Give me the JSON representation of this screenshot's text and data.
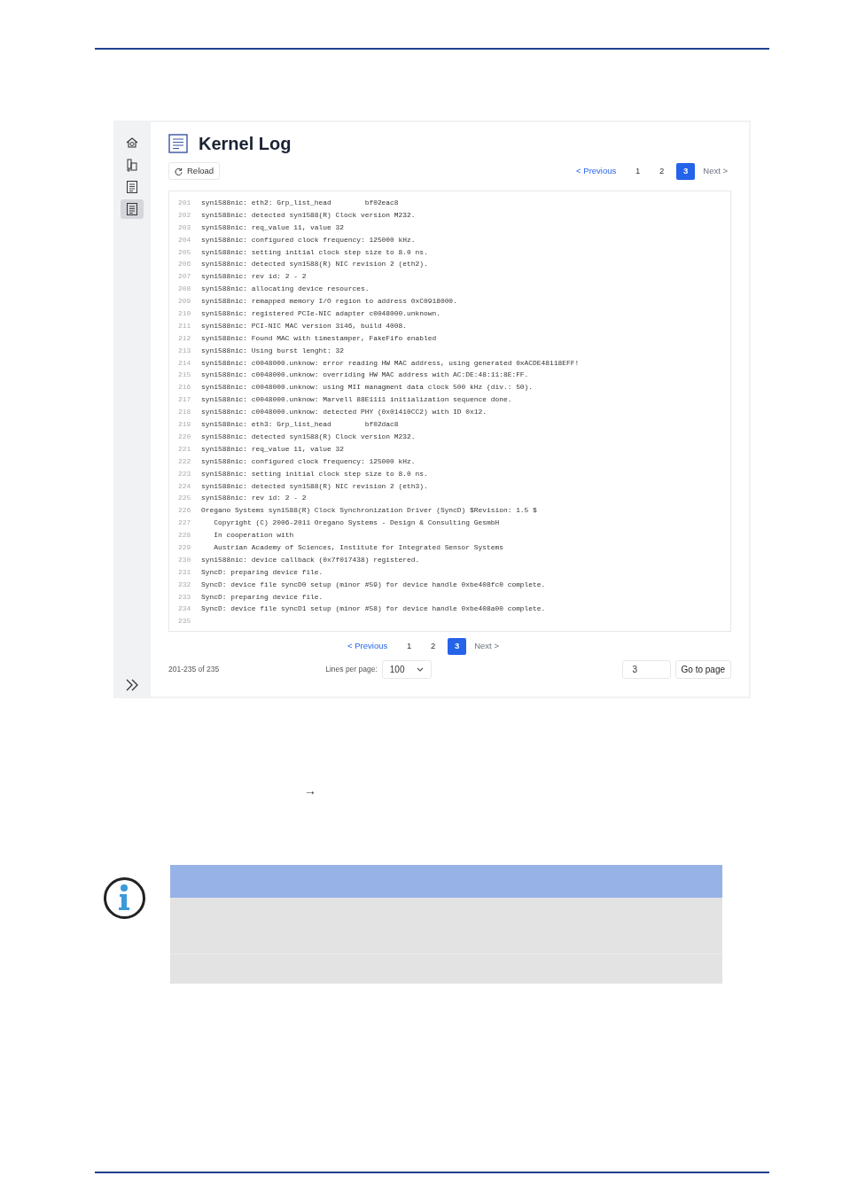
{
  "sidebar": {
    "items": [
      {
        "kind": "home",
        "selected": false
      },
      {
        "kind": "device",
        "selected": false
      },
      {
        "kind": "log",
        "selected": false
      },
      {
        "kind": "log",
        "selected": true
      }
    ]
  },
  "title": "Kernel Log",
  "reload_button": "Reload",
  "top_pagination": {
    "previous": "< Previous",
    "next": "Next >",
    "pages": [
      {
        "label": "1",
        "selected": false
      },
      {
        "label": "2",
        "selected": false
      },
      {
        "label": "3",
        "selected": true
      }
    ]
  },
  "log_lines": [
    {
      "number": "201",
      "text": "syn1588nic: eth2: Grp_list_head        bf02eac8"
    },
    {
      "number": "202",
      "text": "syn1588nic: detected syn1588(R) Clock version M232."
    },
    {
      "number": "203",
      "text": "syn1588nic: req_value 11, value 32"
    },
    {
      "number": "204",
      "text": "syn1588nic: configured clock frequency: 125000 kHz."
    },
    {
      "number": "205",
      "text": "syn1588nic: setting initial clock step size to 8.0 ns."
    },
    {
      "number": "206",
      "text": "syn1588nic: detected syn1588(R) NIC revision 2 (eth2)."
    },
    {
      "number": "207",
      "text": "syn1588nic: rev id: 2 - 2"
    },
    {
      "number": "208",
      "text": "syn1588nic: allocating device resources."
    },
    {
      "number": "209",
      "text": "syn1588nic: remapped memory I/O region to address 0xC0918000."
    },
    {
      "number": "210",
      "text": "syn1588nic: registered PCIe-NIC adapter c0048000.unknown."
    },
    {
      "number": "211",
      "text": "syn1588nic: PCI-NIC MAC version 3146, build 4008."
    },
    {
      "number": "212",
      "text": "syn1588nic: Found MAC with timestamper, FakeFifo enabled"
    },
    {
      "number": "213",
      "text": "syn1588nic: Using burst lenght: 32"
    },
    {
      "number": "214",
      "text": "syn1588nic: c0048000.unknow: error reading HW MAC address, using generated 0xACDE48118EFF!"
    },
    {
      "number": "215",
      "text": "syn1588nic: c0048000.unknow: overriding HW MAC address with AC:DE:48:11:8E:FF."
    },
    {
      "number": "216",
      "text": "syn1588nic: c0048000.unknow: using MII managment data clock 500 kHz (div.: 50)."
    },
    {
      "number": "217",
      "text": "syn1588nic: c0048000.unknow: Marvell 88E1111 initialization sequence done."
    },
    {
      "number": "218",
      "text": "syn1588nic: c0048000.unknow: detected PHY (0x01410CC2) with ID 0x12."
    },
    {
      "number": "219",
      "text": "syn1588nic: eth3: Grp_list_head        bf02dac8"
    },
    {
      "number": "220",
      "text": "syn1588nic: detected syn1588(R) Clock version M232."
    },
    {
      "number": "221",
      "text": "syn1588nic: req_value 11, value 32"
    },
    {
      "number": "222",
      "text": "syn1588nic: configured clock frequency: 125000 kHz."
    },
    {
      "number": "223",
      "text": "syn1588nic: setting initial clock step size to 8.0 ns."
    },
    {
      "number": "224",
      "text": "syn1588nic: detected syn1588(R) NIC revision 2 (eth3)."
    },
    {
      "number": "225",
      "text": "syn1588nic: rev id: 2 - 2"
    },
    {
      "number": "226",
      "text": "Oregano Systems syn1588(R) Clock Synchronization Driver (SyncD) $Revision: 1.5 $"
    },
    {
      "number": "227",
      "text": "   Copyright (C) 2006-2011 Oregano Systems - Design & Consulting GesmbH"
    },
    {
      "number": "228",
      "text": "   In cooperation with"
    },
    {
      "number": "229",
      "text": "   Austrian Academy of Sciences, Institute for Integrated Sensor Systems"
    },
    {
      "number": "230",
      "text": "syn1588nic: device callback (0x7f017438) registered."
    },
    {
      "number": "231",
      "text": "SyncD: preparing device file."
    },
    {
      "number": "232",
      "text": "SyncD: device file syncD0 setup (minor #59) for device handle 0xbe408fc0 complete."
    },
    {
      "number": "233",
      "text": "SyncD: preparing device file."
    },
    {
      "number": "234",
      "text": "SyncD: device file syncD1 setup (minor #58) for device handle 0xbe408a00 complete."
    },
    {
      "number": "235"
    }
  ],
  "bottom_pagination": {
    "previous": "< Previous",
    "next": "Next >",
    "pages": [
      {
        "label": "1",
        "selected": false
      },
      {
        "label": "2",
        "selected": false
      },
      {
        "label": "3",
        "selected": true
      }
    ]
  },
  "footer": {
    "range": "201-235 of 235",
    "lines_per_page_label": "Lines per page:",
    "lines_per_page": "100",
    "goto_value": "3",
    "goto_button": "Go to page"
  },
  "document": {
    "arrow": "→"
  }
}
